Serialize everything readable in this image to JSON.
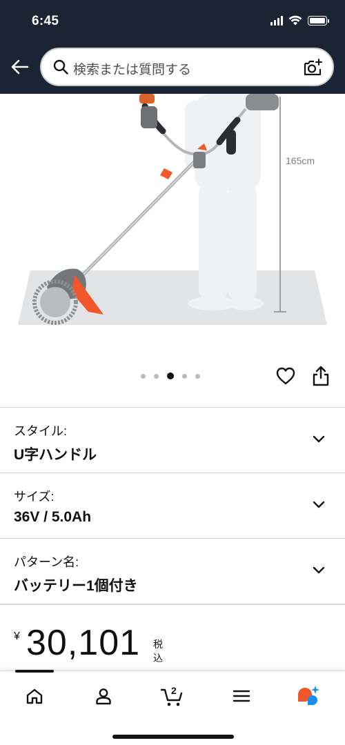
{
  "status_bar": {
    "time": "6:45",
    "icons": [
      "cellular-signal-icon",
      "wifi-icon",
      "battery-icon"
    ]
  },
  "header": {
    "back_icon": "back-arrow-icon",
    "search_placeholder": "検索または質問する",
    "search_icon": "search-icon",
    "camera_icon": "camera-search-icon"
  },
  "product_image": {
    "height_label": "165cm",
    "total_images": 5,
    "active_image": 3
  },
  "actions": {
    "favorite_icon": "heart-icon",
    "share_icon": "share-icon"
  },
  "variations": [
    {
      "label": "スタイル:",
      "value": "U字ハンドル"
    },
    {
      "label": "サイズ:",
      "value": "36V / 5.0Ah"
    },
    {
      "label": "パターン名:",
      "value": "バッテリー1個付き"
    }
  ],
  "price": {
    "currency": "¥",
    "amount": "30,101",
    "tax_note": "税込"
  },
  "bottom_nav": {
    "items": [
      "home-icon",
      "account-icon",
      "cart-icon",
      "menu-icon",
      "rufus-ai-icon"
    ],
    "cart_count": "2",
    "active_index": 0
  },
  "colors": {
    "header_bg": "#1a2433",
    "accent_orange": "#f2562b",
    "ai_blue": "#1a8cf0"
  }
}
